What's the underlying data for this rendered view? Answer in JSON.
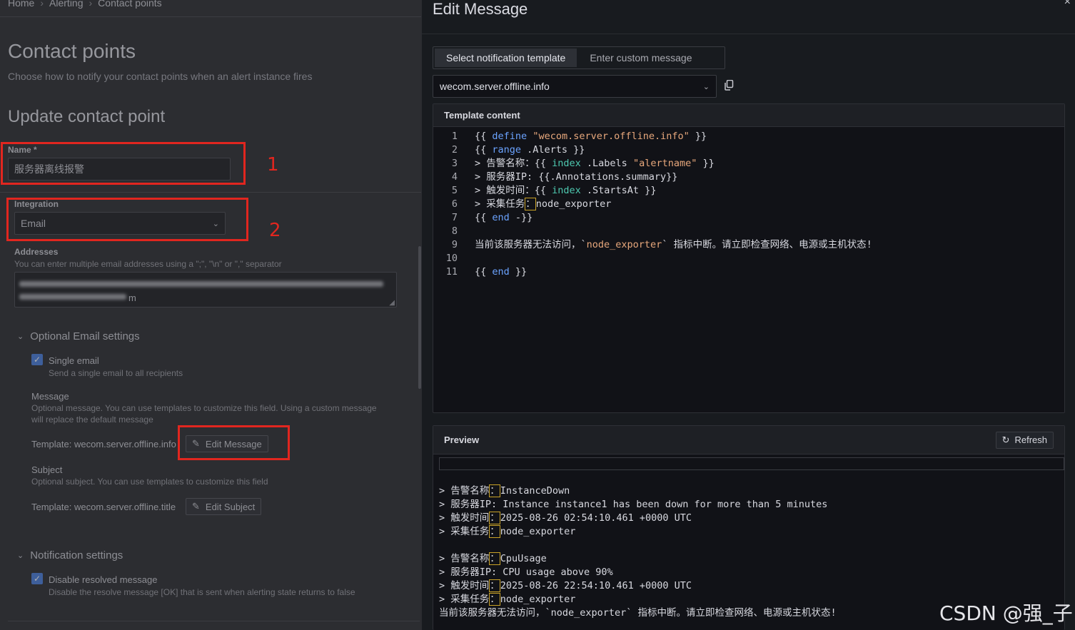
{
  "breadcrumb": {
    "home": "Home",
    "alerting": "Alerting",
    "current": "Contact points",
    "sep": "›"
  },
  "page": {
    "title": "Contact points",
    "subtitle": "Choose how to notify your contact points when an alert instance fires",
    "section_title": "Update contact point"
  },
  "form": {
    "name_label": "Name *",
    "name_value": "服务器离线报警",
    "integration_label": "Integration",
    "integration_value": "Email",
    "addresses_label": "Addresses",
    "addresses_desc": "You can enter multiple email addresses using a \";\", \"\\n\" or \",\" separator",
    "addresses_tail": "m",
    "optional_email_title": "Optional Email settings",
    "single_email_label": "Single email",
    "single_email_desc": "Send a single email to all recipients",
    "message_label": "Message",
    "message_desc": "Optional message. You can use templates to customize this field. Using a custom message will replace the default message",
    "message_template": "Template: wecom.server.offline.info",
    "edit_message_btn": "Edit Message",
    "subject_label": "Subject",
    "subject_desc": "Optional subject. You can use templates to customize this field",
    "subject_template": "Template: wecom.server.offline.title",
    "edit_subject_btn": "Edit Subject",
    "notification_title": "Notification settings",
    "disable_resolved_label": "Disable resolved message",
    "disable_resolved_desc": "Disable the resolve message [OK] that is sent when alerting state returns to false"
  },
  "annotations": {
    "one": "1",
    "two": "2"
  },
  "drawer": {
    "title": "Edit Message",
    "close": "×",
    "tabs": [
      "Select notification template",
      "Enter custom message"
    ],
    "selected_template": "wecom.server.offline.info",
    "template_content_title": "Template content",
    "preview_title": "Preview",
    "refresh_label": "Refresh"
  },
  "watermark": "CSDN @强_子",
  "colors": {
    "accent": "#4a7fdc",
    "annotation_red": "#e1261f",
    "keyword": "#6ba3ff",
    "string": "#e8a87c",
    "func": "#4ec9b0"
  }
}
